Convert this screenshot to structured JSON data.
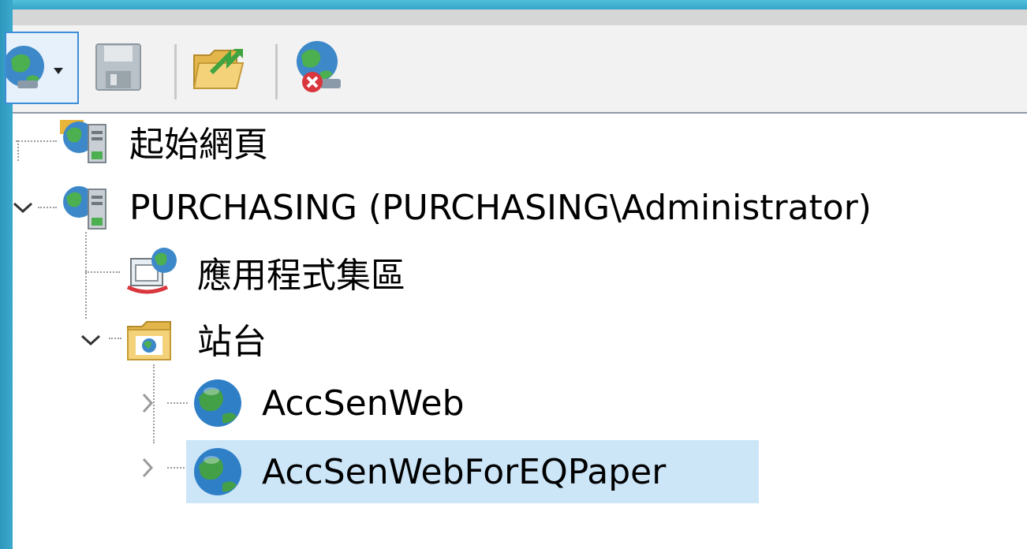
{
  "toolbar": {
    "buttons": [
      {
        "name": "connect",
        "icon": "globe-connect-icon"
      },
      {
        "name": "save",
        "icon": "floppy-save-icon"
      },
      {
        "name": "open-folder",
        "icon": "folder-open-icon"
      },
      {
        "name": "disconnect",
        "icon": "globe-disconnect-icon"
      }
    ]
  },
  "tree": {
    "start_page": {
      "label": "起始網頁",
      "icon": "start-page-icon"
    },
    "server": {
      "label": "PURCHASING (PURCHASING\\Administrator)",
      "icon": "server-icon",
      "expanded": true
    },
    "app_pools": {
      "label": "應用程式集區",
      "icon": "app-pool-icon"
    },
    "sites": {
      "label": "站台",
      "icon": "sites-folder-icon",
      "expanded": true
    },
    "site_items": [
      {
        "label": "AccSenWeb",
        "icon": "globe-icon",
        "expanded": false,
        "selected": false
      },
      {
        "label": "AccSenWebForEQPaper",
        "icon": "globe-icon",
        "expanded": false,
        "selected": true
      }
    ]
  },
  "colors": {
    "frame": "#3aa6c9",
    "selection": "#cce6f8",
    "toolbar_bg": "#f2f2f2"
  }
}
